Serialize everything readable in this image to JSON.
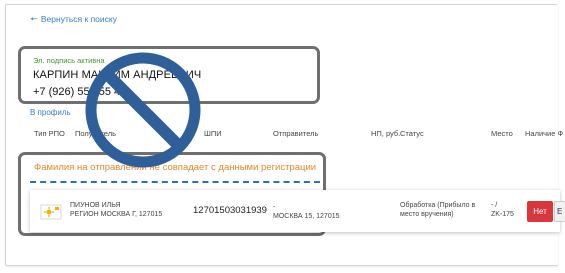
{
  "nav": {
    "back_label": "Вернуться к поиску"
  },
  "signature": {
    "status": "Эл. подпись активна",
    "name": "КАРПИН МАКСИМ АНДРЕЕВИЧ",
    "phone": "+7 (926) 555 55 46"
  },
  "profile_link": "В профиль",
  "table": {
    "headers": {
      "type": "Тип РПО",
      "recipient": "Получатель",
      "spi": "ШПИ",
      "sender": "Отправитель",
      "np": "НП, руб.",
      "status": "Статус",
      "place": "Место",
      "presence": "Наличие Ф"
    },
    "warning": "Фамилия на отправлении не совпадает с данными регистрации",
    "row": {
      "recipient_line1": "ПИУНОВ ИЛЬЯ",
      "recipient_line2": "РЕГИОН МОСКВА Г, 127015",
      "spi": "12701503031939",
      "sender_line1": "-",
      "sender_line2": "МОСКВА 15, 127015",
      "status_line1": "Обработка (Прибыло в",
      "status_line2": "место вручения)",
      "place_line1": "- /",
      "place_line2": "ZK-175",
      "button_no": "Нет",
      "button_next": "Е"
    }
  },
  "colors": {
    "link": "#3a7ec6",
    "active": "#3f9a2f",
    "warning": "#e38a2b",
    "danger": "#d9363e",
    "overlay": "#2f5f99"
  },
  "icons": {
    "back": "arrow-left-icon",
    "rpo_type": "letter-icon",
    "overlay": "no-entry-sign-icon"
  }
}
